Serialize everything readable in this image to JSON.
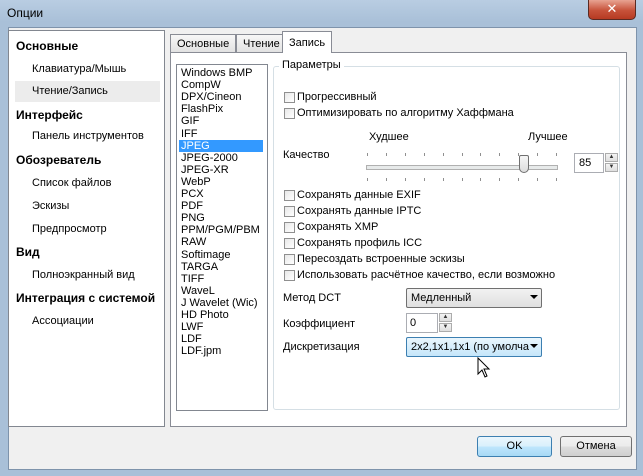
{
  "window": {
    "title": "Опции",
    "close_glyph": "✕"
  },
  "nav": {
    "groups": [
      {
        "label": "Основные",
        "items": [
          "Клавиатура/Мышь",
          "Чтение/Запись"
        ]
      },
      {
        "label": "Интерфейс",
        "items": [
          "Панель инструментов"
        ]
      },
      {
        "label": "Обозреватель",
        "items": [
          "Список файлов",
          "Эскизы",
          "Предпросмотр"
        ]
      },
      {
        "label": "Вид",
        "items": [
          "Полноэкранный вид"
        ]
      },
      {
        "label": "Интеграция с системой",
        "items": [
          "Ассоциации"
        ]
      }
    ],
    "selected_item": "Чтение/Запись"
  },
  "tabs": [
    {
      "label": "Основные"
    },
    {
      "label": "Чтение"
    },
    {
      "label": "Запись"
    }
  ],
  "active_tab": "Запись",
  "formats": [
    "Windows BMP",
    "CompW",
    "DPX/Cineon",
    "FlashPix",
    "GIF",
    "IFF",
    "JPEG",
    "JPEG-2000",
    "JPEG-XR",
    "WebP",
    "PCX",
    "PDF",
    "PNG",
    "PPM/PGM/PBM",
    "RAW",
    "Softimage",
    "TARGA",
    "TIFF",
    "WaveL",
    "J Wavelet (Wic)",
    "HD Photo",
    "LWF",
    "LDF",
    "LDF.jpm"
  ],
  "selected_format": "JPEG",
  "params": {
    "legend": "Параметры",
    "progressive": "Прогрессивный",
    "huffman": "Оптимизировать по алгоритму Хаффмана",
    "quality_label": "Качество",
    "worse": "Худшее",
    "better": "Лучшее",
    "quality_value": "85",
    "quality_fraction": 0.85,
    "save_exif": "Сохранять данные EXIF",
    "save_iptc": "Сохранять данные IPTC",
    "save_xmp": "Сохранять XMP",
    "save_icc": "Сохранять профиль ICC",
    "recreate_thumbs": "Пересоздать встроенные эскизы",
    "use_calc_quality": "Использовать расчётное качество, если возможно",
    "dct_label": "Метод DCT",
    "dct_value": "Медленный",
    "coef_label": "Коэффициент",
    "coef_value": "0",
    "sampling_label": "Дискретизация",
    "sampling_value": "2x2,1x1,1x1 (по умолча"
  },
  "buttons": {
    "ok": "OK",
    "cancel": "Отмена"
  }
}
